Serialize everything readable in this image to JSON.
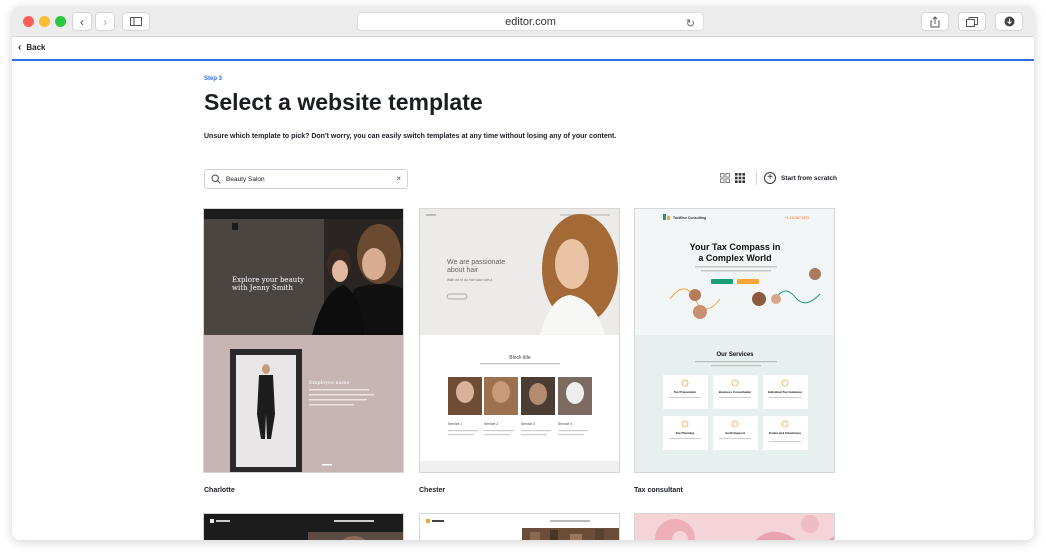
{
  "browser": {
    "url": "editor.com"
  },
  "nav": {
    "back_label": "Back"
  },
  "header": {
    "step": "Step 3",
    "title": "Select a website template",
    "subtitle": "Unsure which template to pick? Don't worry, you can easily switch templates at any time without losing any of your content."
  },
  "search": {
    "value": "Beauty Salon",
    "clear": "×"
  },
  "toolbar": {
    "start_from_scratch": "Start from scratch",
    "plus": "+"
  },
  "templates": [
    {
      "name": "Charlotte",
      "hero_title": "Explore your beauty with Jenny Smith",
      "employee_title": "Employee name"
    },
    {
      "name": "Chester",
      "hero_title": "We are passionate about hair",
      "hero_text": "Walk out of our hair salon with a confident glow - inside and out",
      "block_title": "Block title",
      "service_labels": [
        "Service 1",
        "Service 2",
        "Service 3",
        "Service 4"
      ]
    },
    {
      "name": "Tax consultant",
      "brand": "TaxWise Consulting",
      "cta": "+1 234 567 8970",
      "hero_title_line1": "Your Tax Compass in",
      "hero_title_line2": "a Complex World",
      "services_title": "Our Services",
      "service_items": [
        "Tax Preparation",
        "Business Consultation",
        "Individual Tax Guidance",
        "Tax Planning",
        "Audit Support",
        "Estate and Inheritance Tax"
      ]
    }
  ],
  "colors": {
    "accent": "#2f6fe0",
    "teal": "#1d9d74",
    "orange": "#f7a43a",
    "charlotte_bg": "#c6b5b3"
  }
}
